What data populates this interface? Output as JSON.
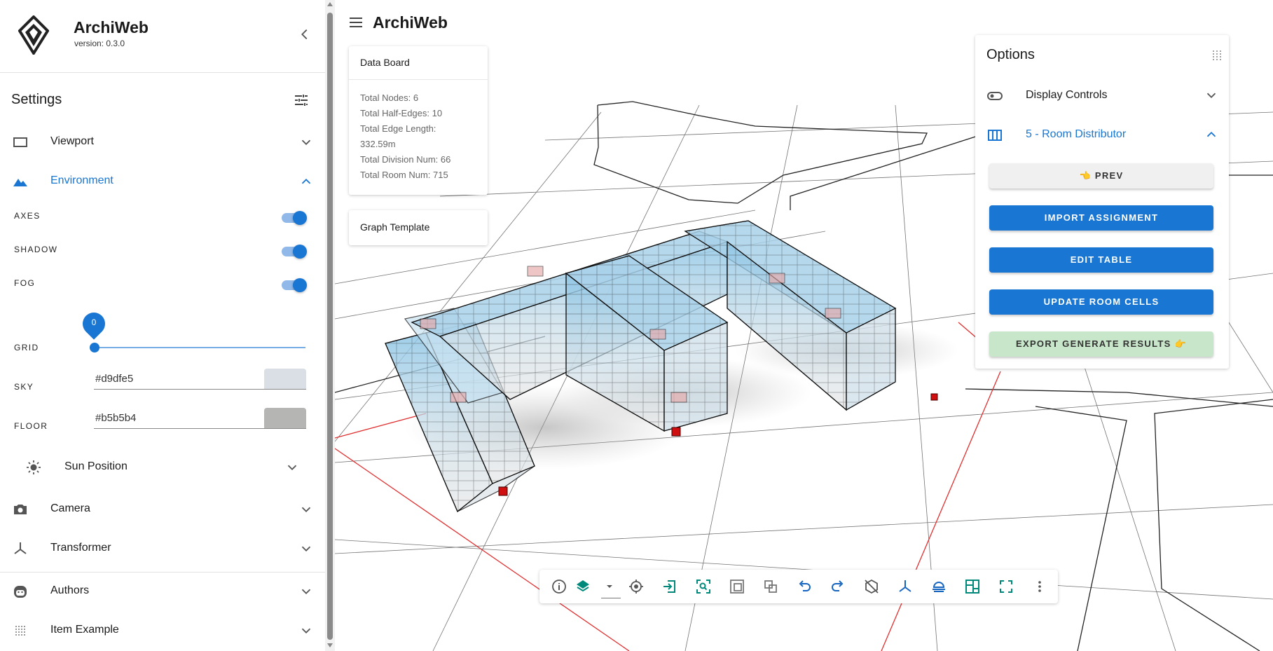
{
  "app": {
    "name": "ArchiWeb",
    "version": "version: 0.3.0"
  },
  "sidebar": {
    "settings_title": "Settings",
    "items": {
      "viewport": "Viewport",
      "environment": "Environment",
      "sun_position": "Sun Position",
      "camera": "Camera",
      "transformer": "Transformer",
      "authors": "Authors",
      "item_example": "Item Example"
    },
    "environment": {
      "axes_label": "AXES",
      "axes_on": true,
      "shadow_label": "SHADOW",
      "shadow_on": true,
      "fog_label": "FOG",
      "fog_on": true,
      "grid_label": "GRID",
      "grid_value": "0",
      "sky_label": "SKY",
      "sky_value": "#d9dfe5",
      "floor_label": "FLOOR",
      "floor_value": "#b5b5b4"
    }
  },
  "topbar": {
    "title": "ArchiWeb"
  },
  "data_board": {
    "title": "Data Board",
    "stats": [
      "Total Nodes: 6",
      "Total Half-Edges: 10",
      "Total Edge Length:",
      "332.59m",
      "Total Division Num: 66",
      "Total Room Num: 715"
    ]
  },
  "graph_template": {
    "title": "Graph Template"
  },
  "options": {
    "title": "Options",
    "display_controls": "Display Controls",
    "room_distributor": "5 - Room Distributor",
    "buttons": {
      "prev": "👈 PREV",
      "import_assignment": "IMPORT ASSIGNMENT",
      "edit_table": "EDIT TABLE",
      "update_room_cells": "UPDATE ROOM CELLS",
      "export_results": "EXPORT GENERATE RESULTS 👉"
    }
  },
  "colors": {
    "accent": "#1976d2",
    "sky": "#d9dfe5",
    "floor": "#b5b5b4",
    "export_button": "#c8e6c9"
  },
  "toolbar_icons": [
    "info-icon",
    "layers-icon",
    "dropdown-icon",
    "locate-icon",
    "import-icon",
    "zoom-fit-icon",
    "select-box-icon",
    "group-icon",
    "undo-icon",
    "redo-icon",
    "box-icon",
    "axes-icon",
    "weather-icon",
    "layout-icon",
    "fullscreen-icon",
    "more-icon"
  ]
}
